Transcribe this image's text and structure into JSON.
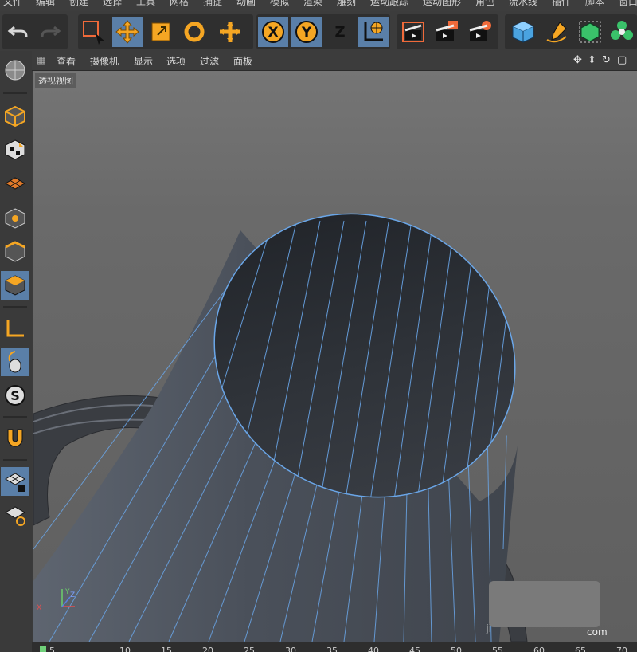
{
  "menu": [
    "文件",
    "编辑",
    "创建",
    "选择",
    "工具",
    "网格",
    "捕捉",
    "动画",
    "模拟",
    "渲染",
    "雕刻",
    "运动跟踪",
    "运动图形",
    "角色",
    "流水线",
    "插件",
    "脚本",
    "窗口"
  ],
  "toolbar": {
    "undo_icon": "undo-icon",
    "redo_icon": "redo-icon",
    "axis_x_label": "X",
    "axis_y_label": "Y",
    "axis_z_label": "Z",
    "accent_color": "#f5a623",
    "active_color": "#5a7fa8"
  },
  "viewport_menu": [
    "查看",
    "摄像机",
    "显示",
    "选项",
    "过滤",
    "面板"
  ],
  "viewport": {
    "label": "透视视图",
    "nav_icons": [
      "move-view-icon",
      "zoom-view-icon",
      "rotate-view-icon",
      "toggle-view-icon"
    ]
  },
  "watermark": {
    "text_left": "ji",
    "text_right": "com"
  },
  "timeline": {
    "ticks": [
      "0",
      "5",
      "10",
      "15",
      "20",
      "25",
      "30",
      "35",
      "40",
      "45",
      "50",
      "55",
      "60",
      "65",
      "70"
    ]
  }
}
